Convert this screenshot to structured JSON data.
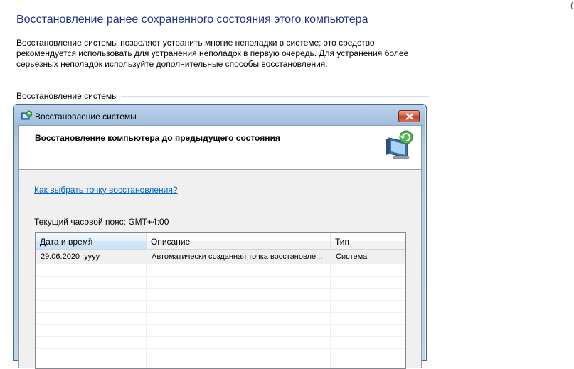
{
  "page": {
    "title": "Восстановление ранее сохраненного состояния этого компьютера",
    "description": "Восстановление системы позволяет устранить многие неполадки в системе; это средство рекомендуется использовать для устранения неполадок в первую очередь. Для устранения более серьезных неполадок используйте дополнительные способы восстановления.",
    "section_label": "Восстановление системы",
    "corner_glyph": "("
  },
  "dialog": {
    "title": "Восстановление системы",
    "icon": "system-restore-icon",
    "header": "Восстановление компьютера до предыдущего состояния",
    "help_link": "Как выбрать точку восстановления?",
    "timezone": "Текущий часовой пояс: GMT+4:00",
    "columns": [
      "Дата и время",
      "Описание",
      "Тип"
    ],
    "rows": [
      {
        "date": "29.06.2020 .yyyy",
        "description": "Автоматически созданная точка восстановле...",
        "type": "Система"
      }
    ]
  },
  "colors": {
    "title_blue": "#1e3287",
    "link_blue": "#0066cc",
    "close_red": "#c63a20"
  }
}
